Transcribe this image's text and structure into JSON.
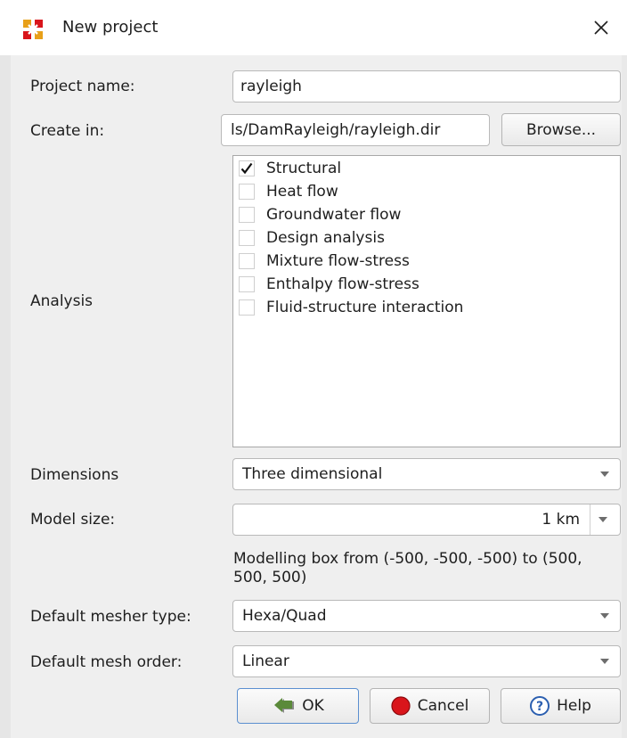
{
  "window": {
    "title": "New project",
    "icon": "diana-logo-icon",
    "close_icon": "close-icon"
  },
  "form": {
    "project_name_label": "Project name:",
    "project_name_value": "rayleigh",
    "create_in_label": "Create in:",
    "create_in_value": "ls/DamRayleigh/rayleigh.dir",
    "browse_label": "Browse...",
    "analysis_label": "Analysis",
    "analysis_items": [
      {
        "label": "Structural",
        "checked": true
      },
      {
        "label": "Heat flow",
        "checked": false
      },
      {
        "label": "Groundwater flow",
        "checked": false
      },
      {
        "label": "Design analysis",
        "checked": false
      },
      {
        "label": "Mixture flow-stress",
        "checked": false
      },
      {
        "label": "Enthalpy flow-stress",
        "checked": false
      },
      {
        "label": "Fluid-structure interaction",
        "checked": false
      }
    ],
    "dimensions_label": "Dimensions",
    "dimensions_value": "Three dimensional",
    "model_size_label": "Model size:",
    "model_size_value": "1 km",
    "modelling_box_text": "Modelling box from (-500, -500, -500) to (500, 500, 500)",
    "mesher_type_label": "Default mesher type:",
    "mesher_type_value": "Hexa/Quad",
    "mesh_order_label": "Default mesh order:",
    "mesh_order_value": "Linear"
  },
  "buttons": {
    "ok_label": "OK",
    "cancel_label": "Cancel",
    "help_label": "Help"
  },
  "colors": {
    "cancel_icon": "#d9151b",
    "help_icon": "#2b5fb0",
    "ok_icon": "#5b8a3a",
    "default_button_border": "#5b8fd0"
  }
}
